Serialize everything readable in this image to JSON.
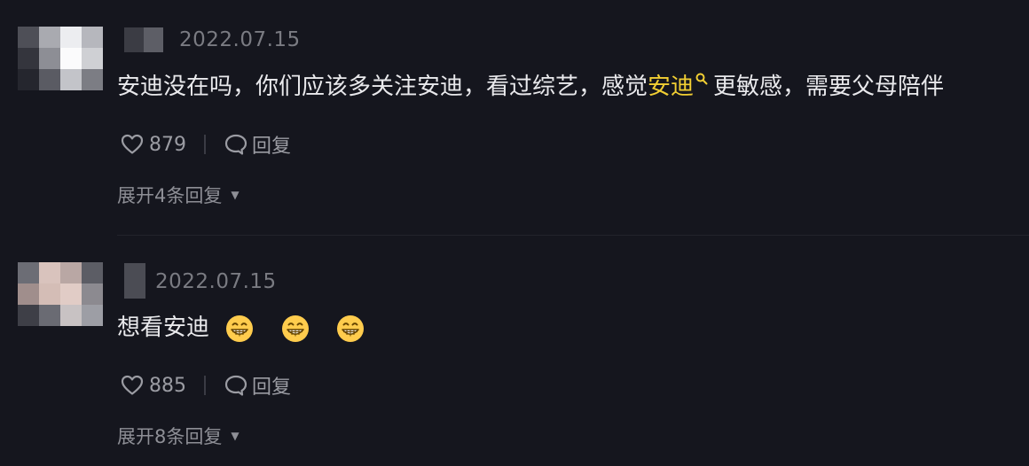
{
  "comments": [
    {
      "date": "2022.07.15",
      "text_before": "安迪没在吗，你们应该多关注安迪，看过综艺，感觉",
      "text_link": "安迪",
      "text_after": "更敏感，需要父母陪伴",
      "likes": "879",
      "reply_label": "回复",
      "expand_label": "展开4条回复"
    },
    {
      "date": "2022.07.15",
      "text_before": "想看安迪",
      "likes": "885",
      "reply_label": "回复",
      "expand_label": "展开8条回复"
    }
  ],
  "icons": {
    "like": "heart-outline-icon",
    "reply": "speech-bubble-icon",
    "expand": "caret-down-icon",
    "search": "search-icon",
    "emoji": "grinning-face-emoji"
  },
  "colors": {
    "background": "#15161e",
    "text": "#e9e9ec",
    "muted": "#9b9ca3",
    "link": "#f2cf33"
  }
}
